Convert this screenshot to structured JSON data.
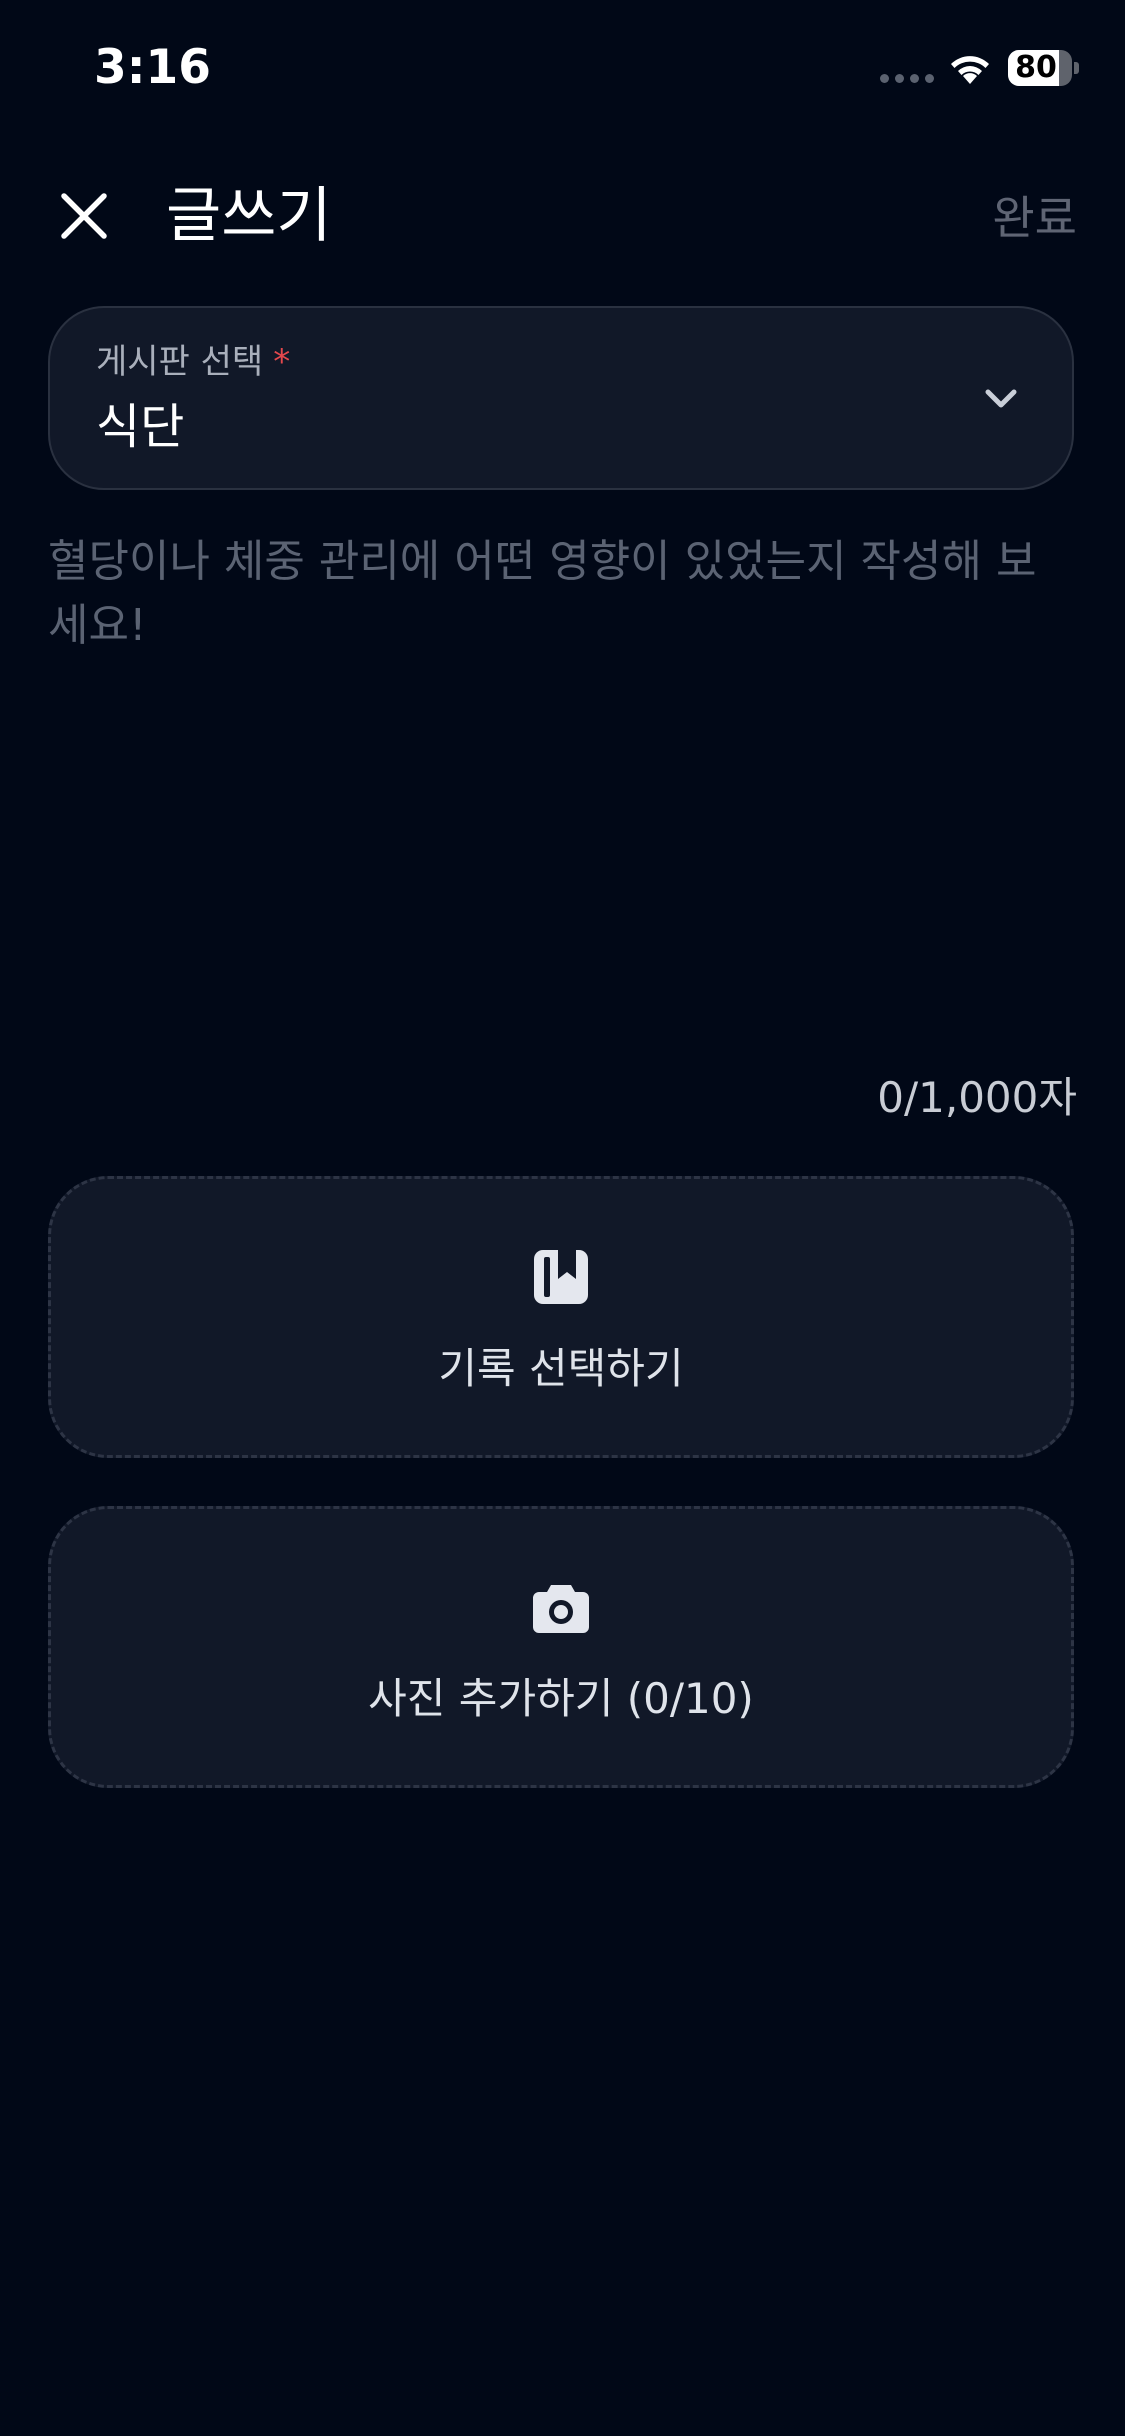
{
  "status_bar": {
    "time": "3:16",
    "battery_level": "80",
    "battery_fraction": 0.8
  },
  "header": {
    "title": "글쓰기",
    "done_label": "완료"
  },
  "board_select": {
    "label": "게시판 선택",
    "required_mark": "*",
    "value": "식단"
  },
  "editor": {
    "placeholder": "혈당이나 체중 관리에 어떤 영향이 있었는지 작성해 보세요!",
    "value": "",
    "counter": "0/1,000자"
  },
  "actions": {
    "record_label": "기록 선택하기",
    "photo_label": "사진 추가하기 (0/10)"
  },
  "icons": {
    "close": "close-icon",
    "chevron": "chevron-down-icon",
    "record": "book-bookmark-icon",
    "photo": "camera-icon"
  },
  "colors": {
    "background": "#010817",
    "surface": "#111828",
    "border": "#2a3140",
    "required": "#e5484d",
    "muted_text": "#5f6574"
  }
}
